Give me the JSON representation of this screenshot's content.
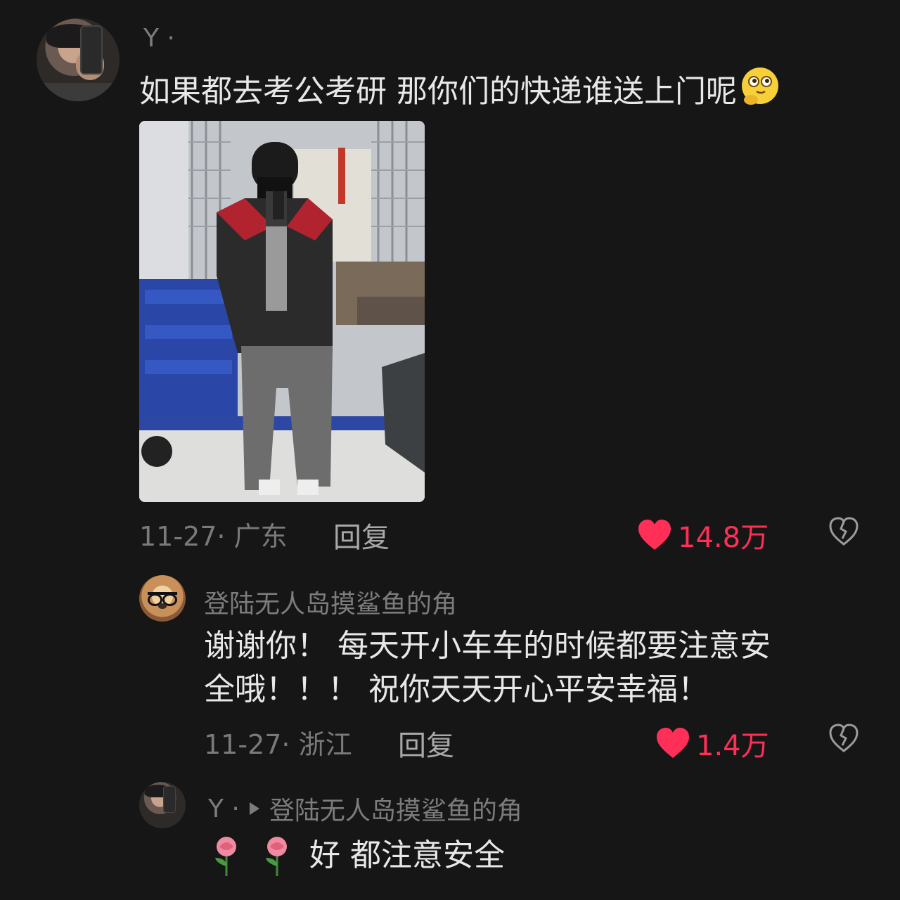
{
  "comments": [
    {
      "username": "Y ·",
      "text": "如果都去考公考研 那你们的快递谁送上门呢",
      "meta": "11-27· 广东",
      "reply_label": "回复",
      "likes": "14.8万"
    },
    {
      "username": "登陆无人岛摸鲨鱼的角",
      "text_line1": "谢谢你！ 每天开小车车的时候都要注意安",
      "text_line2": "全哦！！！ 祝你天天开心平安幸福！",
      "meta": "11-27· 浙江",
      "reply_label": "回复",
      "likes": "1.4万"
    },
    {
      "username": "Y ·",
      "reply_to": "登陆无人岛摸鲨鱼的角",
      "text": "好 都注意安全"
    }
  ],
  "colors": {
    "background": "#161616",
    "like_red": "#ff2f58",
    "muted": "#7a7a7a"
  },
  "icons": [
    "thinking-face-emoji",
    "heart-icon",
    "broken-heart-icon",
    "rose-emoji",
    "reply-arrow-icon"
  ]
}
